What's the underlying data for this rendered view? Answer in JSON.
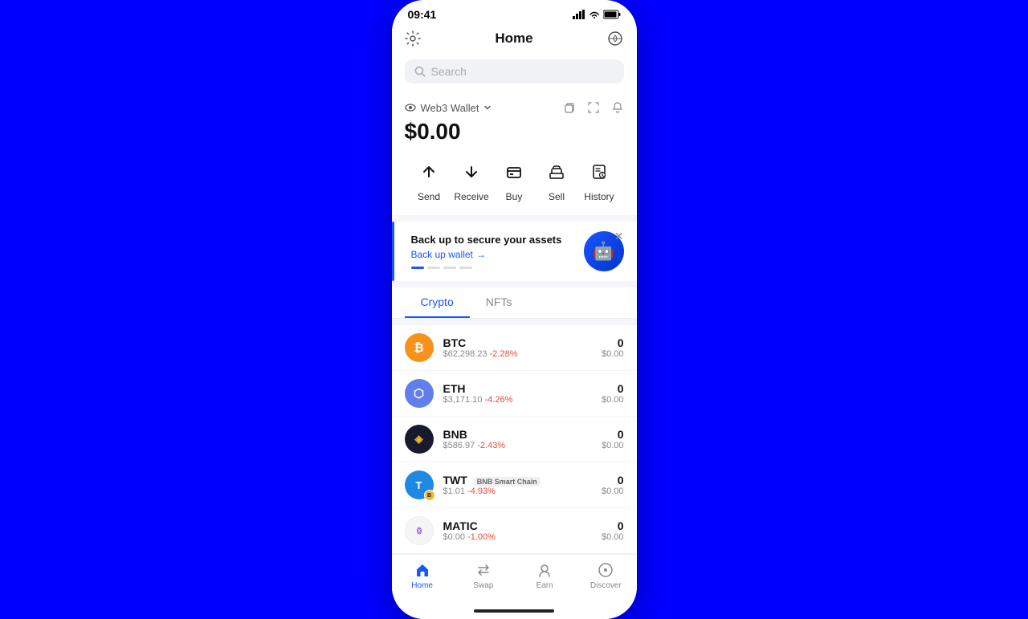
{
  "statusBar": {
    "time": "09:41"
  },
  "header": {
    "title": "Home"
  },
  "search": {
    "placeholder": "Search"
  },
  "wallet": {
    "label": "Web3 Wallet",
    "balance": "$0.00"
  },
  "actions": [
    {
      "id": "send",
      "label": "Send",
      "icon": "↑"
    },
    {
      "id": "receive",
      "label": "Receive",
      "icon": "↓"
    },
    {
      "id": "buy",
      "label": "Buy",
      "icon": "🟦"
    },
    {
      "id": "sell",
      "label": "Sell",
      "icon": "🏛"
    },
    {
      "id": "history",
      "label": "History",
      "icon": "📋"
    }
  ],
  "banner": {
    "title": "Back up to secure your assets",
    "link": "Back up wallet"
  },
  "tabs": [
    {
      "id": "crypto",
      "label": "Crypto",
      "active": true
    },
    {
      "id": "nfts",
      "label": "NFTs",
      "active": false
    }
  ],
  "cryptos": [
    {
      "symbol": "BTC",
      "name": "BTC",
      "price": "$62,298.23",
      "change": "-2.28%",
      "amount": "0",
      "usd": "$0.00",
      "color": "#f7931a",
      "textColor": "#fff",
      "glyph": "₿"
    },
    {
      "symbol": "ETH",
      "name": "ETH",
      "price": "$3,171.10",
      "change": "-4.26%",
      "amount": "0",
      "usd": "$0.00",
      "color": "#627eea",
      "textColor": "#fff",
      "glyph": "⟠"
    },
    {
      "symbol": "BNB",
      "name": "BNB",
      "price": "$586.97",
      "change": "-2.43%",
      "amount": "0",
      "usd": "$0.00",
      "color": "#f3ba2f",
      "textColor": "#fff",
      "glyph": "B"
    },
    {
      "symbol": "TWT",
      "name": "TWT",
      "chain": "BNB Smart Chain",
      "price": "$1.01",
      "change": "-4.93%",
      "amount": "0",
      "usd": "$0.00",
      "color": "#1e88e5",
      "textColor": "#fff",
      "glyph": "T"
    },
    {
      "symbol": "MATIC",
      "name": "MATIC",
      "price": "$0.00",
      "change": "-1.00%",
      "amount": "0",
      "usd": "$0.00",
      "color": "#8247e5",
      "textColor": "#fff",
      "glyph": "M"
    }
  ],
  "bottomNav": [
    {
      "id": "home",
      "label": "Home",
      "active": true
    },
    {
      "id": "swap",
      "label": "Swap",
      "active": false
    },
    {
      "id": "earn",
      "label": "Earn",
      "active": false
    },
    {
      "id": "discover",
      "label": "Discover",
      "active": false
    }
  ]
}
